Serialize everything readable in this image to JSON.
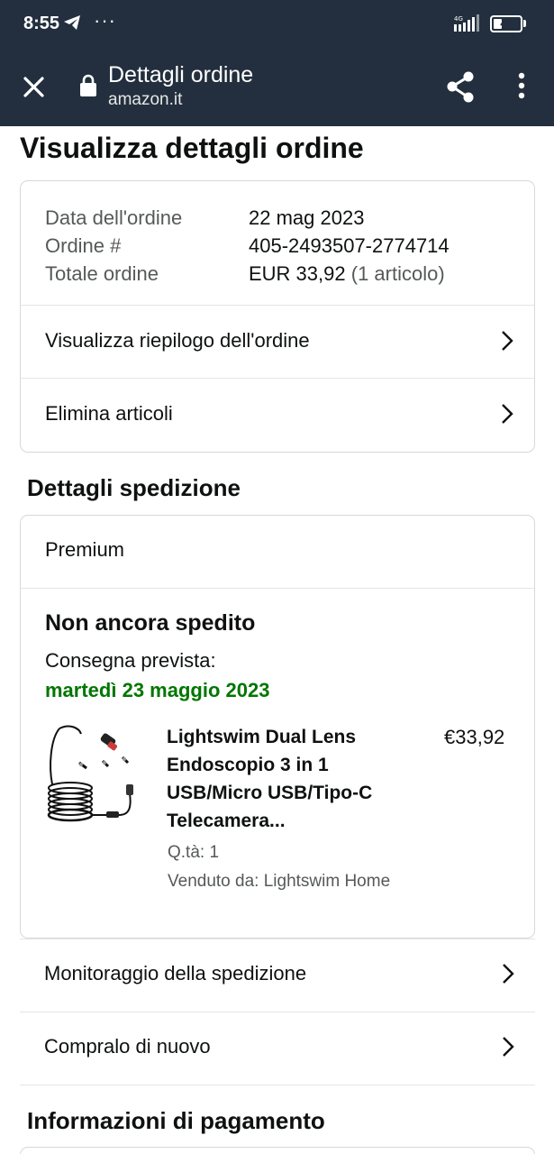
{
  "status_bar": {
    "time": "8:55",
    "dots": "···",
    "network": "4G",
    "battery": "41",
    "battery_level": 0.41,
    "icons": [
      "telegram-icon",
      "signal-icon",
      "battery-icon"
    ]
  },
  "app_bar": {
    "title": "Dettagli ordine",
    "domain": "amazon.it",
    "icons": [
      "close-icon",
      "lock-icon",
      "share-icon",
      "more-vert-icon"
    ]
  },
  "page_title": "Visualizza dettagli ordine",
  "order_summary": {
    "date_label": "Data dell'ordine",
    "date_value": "22 mag 2023",
    "number_label": "Ordine #",
    "number_value": "405-2493507-2774714",
    "total_label": "Totale ordine",
    "total_value": "EUR 33,92",
    "total_items": "(1 articolo)",
    "links": [
      {
        "label": "Visualizza riepilogo dell'ordine"
      },
      {
        "label": "Elimina articoli"
      }
    ]
  },
  "shipment": {
    "heading": "Dettagli spedizione",
    "method": "Premium",
    "status": "Non ancora spedito",
    "eta_label": "Consegna prevista:",
    "eta_date": "martedì 23 maggio 2023",
    "item": {
      "title": "Lightswim Dual Lens Endoscopio 3 in 1 USB/Micro USB/Tipo-C Telecamera...",
      "price": "€33,92",
      "qty": "Q.tà: 1",
      "seller": "Venduto da: Lightswim Home"
    },
    "links": [
      {
        "label": "Monitoraggio della spedizione"
      },
      {
        "label": "Compralo di nuovo"
      }
    ]
  },
  "payment": {
    "heading": "Informazioni di pagamento"
  },
  "colors": {
    "header_bg": "#232f3e",
    "eta_green": "#007600",
    "muted_text": "#565959",
    "border": "#d5d9d9"
  }
}
